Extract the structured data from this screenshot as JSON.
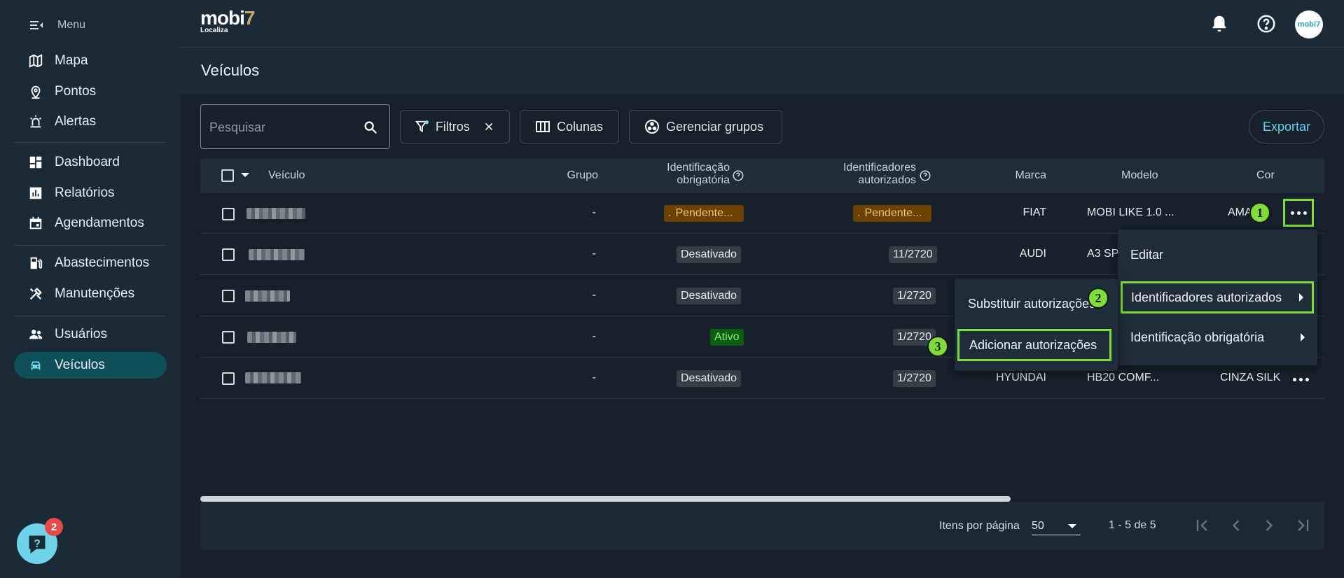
{
  "sidebar": {
    "menu_label": "Menu",
    "items": [
      {
        "label": "Mapa"
      },
      {
        "label": "Pontos"
      },
      {
        "label": "Alertas"
      },
      {
        "label": "Dashboard"
      },
      {
        "label": "Relatórios"
      },
      {
        "label": "Agendamentos"
      },
      {
        "label": "Abastecimentos"
      },
      {
        "label": "Manutenções"
      },
      {
        "label": "Usuários"
      },
      {
        "label": "Veículos"
      }
    ],
    "active": "Veículos",
    "help_badge": "2"
  },
  "header": {
    "logo_main": "mobi",
    "logo_seven": "7",
    "logo_sub": "Localiza",
    "avatar_text": "mobi7"
  },
  "page": {
    "title": "Veículos"
  },
  "toolbar": {
    "search_placeholder": "Pesquisar",
    "filters_label": "Filtros",
    "columns_label": "Colunas",
    "groups_label": "Gerenciar grupos",
    "export_label": "Exportar"
  },
  "table": {
    "headers": {
      "vehicle": "Veículo",
      "group": "Grupo",
      "required_id_1": "Identificação",
      "required_id_2": "obrigatória",
      "authorized_ids_1": "Identificadores",
      "authorized_ids_2": "autorizados",
      "brand": "Marca",
      "model": "Modelo",
      "color": "Cor"
    },
    "rows": [
      {
        "group": "-",
        "required_id": "Pendente...",
        "authorized": "Pendente...",
        "brand": "FIAT",
        "model": "MOBI LIKE 1.0 ...",
        "color": "AMA..."
      },
      {
        "group": "-",
        "required_id": "Desativado",
        "authorized": "11/2720",
        "brand": "AUDI",
        "model": "A3 SPO...",
        "color": ""
      },
      {
        "group": "-",
        "required_id": "Desativado",
        "authorized": "1/2720",
        "brand": "",
        "model": "",
        "color": ""
      },
      {
        "group": "-",
        "required_id": "Ativo",
        "authorized": "1/2720",
        "brand": "",
        "model": "",
        "color": ""
      },
      {
        "group": "-",
        "required_id": "Desativado",
        "authorized": "1/2720",
        "brand": "HYUNDAI",
        "model": "HB20 COMF...",
        "color": "CINZA SILK"
      }
    ]
  },
  "context_menu": {
    "items": [
      "Editar",
      "Identificadores autorizados",
      "Identificação obrigatória"
    ]
  },
  "submenu": {
    "items": [
      "Substituir autorizações",
      "Adicionar autorizações"
    ]
  },
  "steps": [
    "1",
    "2",
    "3"
  ],
  "pagination": {
    "items_per_page_label": "Itens por página",
    "items_per_page": "50",
    "range": "1 - 5 de 5"
  },
  "colors": {
    "accent": "#6fd9e6",
    "highlight": "#7fdc3a",
    "pending": "#6b4200",
    "active": "#0f5d14"
  }
}
